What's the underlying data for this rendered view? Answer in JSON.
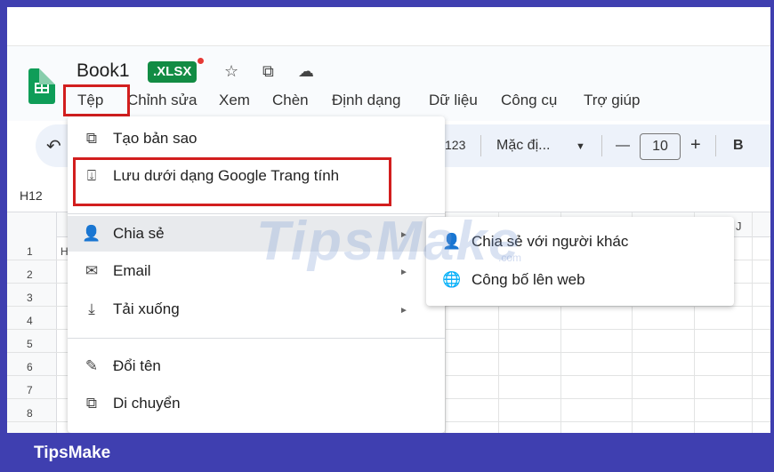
{
  "document": {
    "title": "Book1",
    "format_badge": ".XLSX"
  },
  "menubar": {
    "items": [
      "Tệp",
      "Chỉnh sửa",
      "Xem",
      "Chèn",
      "Định dạng",
      "Dữ liệu",
      "Công cụ",
      "Trợ giúp"
    ]
  },
  "toolbar": {
    "number_format": "123",
    "font": "Mặc đị...",
    "font_size": "10",
    "decrease": "—",
    "increase": "+",
    "bold": "B",
    "undo": "↶"
  },
  "name_box": "H12",
  "grid": {
    "rows": [
      "1",
      "2",
      "3",
      "4",
      "5",
      "6",
      "7",
      "8"
    ],
    "visible_col_letter": "J",
    "cell_fragment": "H"
  },
  "file_menu": {
    "items": [
      {
        "label": "Tạo bản sao",
        "icon": "copy-icon"
      },
      {
        "label": "Lưu dưới dạng Google Trang tính",
        "icon": "save-to-sheets-icon"
      },
      {
        "label": "Chia sẻ",
        "icon": "person-add-icon"
      },
      {
        "label": "Email",
        "icon": "mail-icon"
      },
      {
        "label": "Tải xuống",
        "icon": "download-icon"
      },
      {
        "label": "Đổi tên",
        "icon": "rename-icon"
      },
      {
        "label": "Di chuyển",
        "icon": "move-folder-icon"
      }
    ]
  },
  "share_submenu": {
    "items": [
      {
        "label": "Chia sẻ với người khác",
        "icon": "person-add-icon"
      },
      {
        "label": "Công bố lên web",
        "icon": "globe-icon"
      }
    ]
  },
  "watermark": {
    "text": "TipsMake",
    "sub": ".com"
  },
  "footer": {
    "brand": "TipsMake"
  },
  "colors": {
    "frame": "#3f3fb0",
    "highlight_box": "#d21e1e",
    "sheets_green": "#0f9d58",
    "xlsx_badge": "#128c44"
  }
}
